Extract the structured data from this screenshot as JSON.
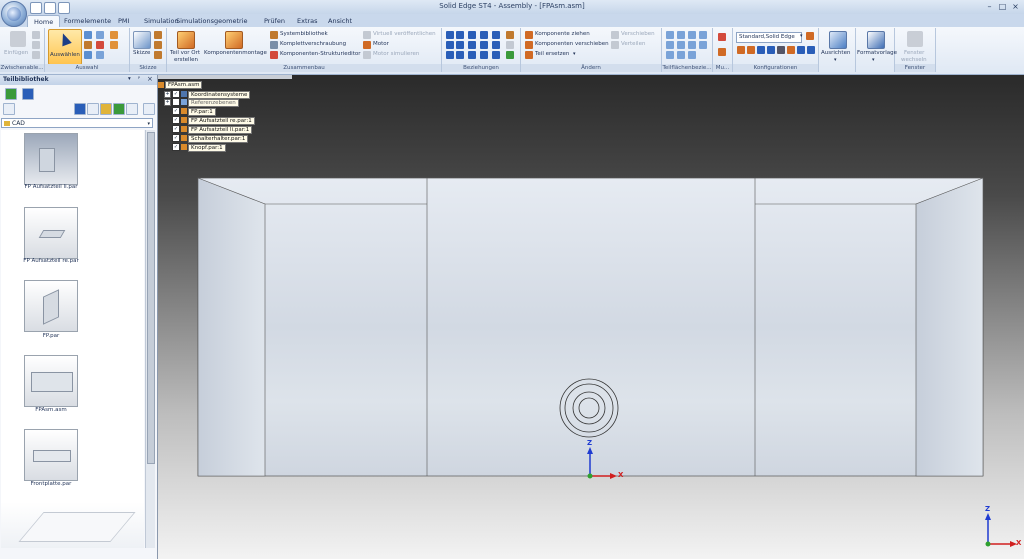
{
  "window": {
    "title": "Solid Edge ST4 - Assembly - [FPAsm.asm]"
  },
  "tabs": [
    {
      "label": "Home",
      "active": true
    },
    {
      "label": "Formelemente"
    },
    {
      "label": "PMI"
    },
    {
      "label": "Simulation"
    },
    {
      "label": "Simulationsgeometrie"
    },
    {
      "label": "Prüfen"
    },
    {
      "label": "Extras"
    },
    {
      "label": "Ansicht"
    }
  ],
  "ribbon": {
    "clipboard": {
      "paste_label": "Einfügen",
      "group_label": "Zwischenable..."
    },
    "select": {
      "select_label": "Auswählen",
      "group_label": "Auswahl"
    },
    "sketch": {
      "sketch_label": "Skizze",
      "group_label": "Skizze"
    },
    "assemble": {
      "part_label_1": "Teil vor Ort",
      "part_label_2": "erstellen",
      "component_label": "Komponentenmontage",
      "item1": "Systembibliothek",
      "item2": "Komplettverschraubung",
      "item3": "Komponenten-Strukturieditor",
      "item4": "Virtuell veröffentlichen",
      "item5": "Motor",
      "item6": "Motor simulieren",
      "group_label": "Zusammenbau"
    },
    "relations": {
      "group_label": "Beziehungen"
    },
    "modify": {
      "item1": "Komponente ziehen",
      "item2": "Komponenten verschieben",
      "item3": "Teil ersetzen",
      "item4": "Verschieben",
      "item5": "Verteilen",
      "group_label": "Ändern"
    },
    "features": {
      "group_label": "Teilflächenbezie..."
    },
    "mu": {
      "group_label": "Mu..."
    },
    "config": {
      "combo_value": "Standard,Solid Edge",
      "group_label": "Konfigurationen"
    },
    "orient": {
      "label": "Ausrichten"
    },
    "format": {
      "label": "Formatvorlage"
    },
    "window_group": {
      "label_1": "Fenster",
      "label_2": "wechseln",
      "group_label": "Fenster"
    }
  },
  "left_panel": {
    "title": "Teilbibliothek",
    "folder": "CAD",
    "items": [
      {
        "label": "FP Aufsatzteil li.par"
      },
      {
        "label": "FP Aufsatzteil re.par"
      },
      {
        "label": "FP.par"
      },
      {
        "label": "FPAsm.asm"
      },
      {
        "label": "Frontplatte.par"
      }
    ]
  },
  "tree": {
    "root": "FPAsm.asm",
    "items": [
      {
        "label": "Koordinatensysteme"
      },
      {
        "label": "Referenzebenen"
      },
      {
        "label": "FP.par:1"
      },
      {
        "label": "FP Aufsatzteil re.par:1"
      },
      {
        "label": "FP Aufsatzteil li.par:1"
      },
      {
        "label": "Schalterhalter.par:1"
      },
      {
        "label": "Knopf.par:1"
      }
    ]
  },
  "triad": {
    "z": "Z",
    "x": "X"
  },
  "colors": {
    "ribbon_bg": "#dfe8f4",
    "tab_bg": "#c9d8ec",
    "model_face": "#d7dde6",
    "axis_z": "#1f3bd1",
    "axis_x": "#d11f1f",
    "axis_y": "#2fa02f"
  }
}
